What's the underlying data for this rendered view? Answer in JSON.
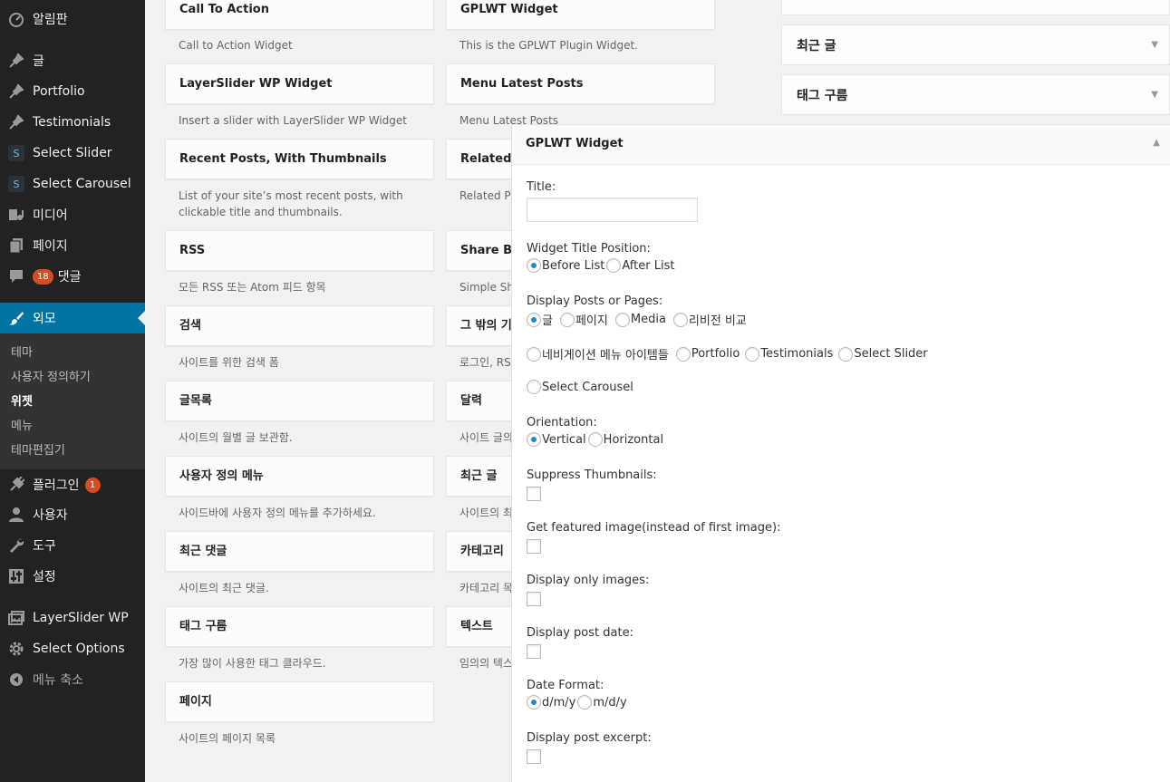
{
  "admin_menu": {
    "dashboard": "알림판",
    "posts": "글",
    "portfolio": "Portfolio",
    "testimonials": "Testimonials",
    "select_slider": "Select Slider",
    "select_carousel": "Select Carousel",
    "media": "미디어",
    "pages": "페이지",
    "comments": "댓글",
    "comments_count": "18",
    "appearance": "외모",
    "appearance_sub": {
      "themes": "테마",
      "customize": "사용자 정의하기",
      "widgets": "위젯",
      "menus": "메뉴",
      "editor": "테마편집기"
    },
    "plugins": "플러그인",
    "plugins_count": "1",
    "users": "사용자",
    "tools": "도구",
    "settings": "설정",
    "layerslider": "LayerSlider WP",
    "select_options": "Select Options",
    "collapse": "메뉴 축소",
    "s_badge": "S"
  },
  "available_widgets": {
    "left": [
      {
        "title": "Call To Action",
        "desc": "Call to Action Widget"
      },
      {
        "title": "LayerSlider WP Widget",
        "desc": "Insert a slider with LayerSlider WP Widget"
      },
      {
        "title": "Recent Posts, With Thumbnails",
        "desc": "List of your site’s most recent posts, with",
        "desc2": "clickable title and thumbnails."
      },
      {
        "title": "RSS",
        "desc": "모든 RSS 또는 Atom 피드 항목"
      },
      {
        "title": "검색",
        "desc": "사이트를 위한 검색 폼"
      },
      {
        "title": "글목록",
        "desc": "사이트의 월별 글 보관함."
      },
      {
        "title": "사용자 정의 메뉴",
        "desc": "사이드바에 사용자 정의 메뉴를 추가하세요."
      },
      {
        "title": "최근 댓글",
        "desc": "사이트의 최근 댓글."
      },
      {
        "title": "태그 구름",
        "desc": "가장 많이 사용한 태그 클라우드."
      },
      {
        "title": "페이지",
        "desc": "사이트의 페이지 목록"
      }
    ],
    "right": [
      {
        "title": "GPLWT Widget",
        "desc": "This is the GPLWT Plugin Widget."
      },
      {
        "title": "Menu Latest Posts",
        "desc": "Menu Latest Posts"
      },
      {
        "title": "Related P",
        "desc": "Related Po"
      },
      {
        "title": "Share Bu",
        "desc": "Simple Sha"
      },
      {
        "title": "그 밖의 기",
        "desc": "로그인, RS"
      },
      {
        "title": "달력",
        "desc": "사이트 글의"
      },
      {
        "title": "최근 글",
        "desc": "사이트의 최"
      },
      {
        "title": "카테고리",
        "desc": "카테고리 목"
      },
      {
        "title": "텍스트",
        "desc": "임의의 텍스"
      }
    ]
  },
  "sidebar_areas": [
    {
      "title": "최근 글"
    },
    {
      "title": "태그 구름"
    }
  ],
  "edit_panel": {
    "title": "GPLWT Widget",
    "title_label": "Title:",
    "title_value": "",
    "title_position_label": "Widget Title Position:",
    "title_position_options": [
      "Before List",
      "After List"
    ],
    "display_label": "Display Posts or Pages:",
    "display_options": [
      "글",
      "페이지",
      "Media",
      "리비전 비교",
      "네비게이션 메뉴 아이템들",
      "Portfolio",
      "Testimonials",
      "Select Slider",
      "Select Carousel"
    ],
    "orientation_label": "Orientation:",
    "orientation_options": [
      "Vertical",
      "Horizontal"
    ],
    "suppress_label": "Suppress Thumbnails:",
    "featured_label": "Get featured image(instead of first image):",
    "only_images_label": "Display only images:",
    "post_date_label": "Display post date:",
    "date_format_label": "Date Format:",
    "date_format_options": [
      "d/m/y",
      "m/d/y"
    ],
    "excerpt_label": "Display post excerpt:"
  }
}
